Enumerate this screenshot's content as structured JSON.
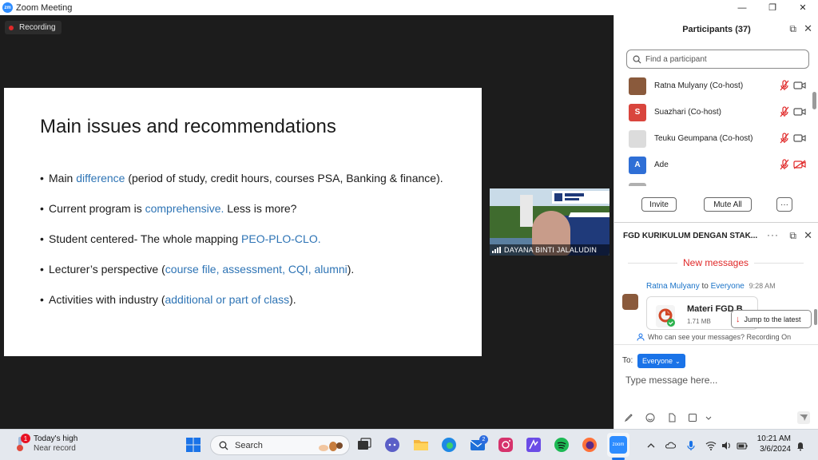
{
  "window": {
    "app_logo": "zm",
    "title": "Zoom Meeting",
    "minimize": "—",
    "restore": "❐",
    "close": "✕"
  },
  "meeting": {
    "recording_label": "Recording",
    "slide": {
      "title": "Main issues and recommendations",
      "bullets": [
        {
          "pre": "Main ",
          "hl": "difference",
          "post": " (period of study, credit hours, courses PSA, Banking & finance)."
        },
        {
          "pre": "Current program is ",
          "hl": "comprehensive.",
          "post": " Less is more?"
        },
        {
          "pre": "Student centered- The whole mapping ",
          "hl": "PEO-PLO-CLO.",
          "post": ""
        },
        {
          "pre": "Lecturer’s perspective (",
          "hl": "course file, assessment, CQI, alumni",
          "post": ")."
        },
        {
          "pre": "Activities with industry (",
          "hl": "additional or part of class",
          "post": ")."
        }
      ]
    },
    "video_tile": {
      "name": "DAYANA BINTI JALALUDIN"
    }
  },
  "participants": {
    "title": "Participants (37)",
    "search_placeholder": "Find a participant",
    "list": [
      {
        "name": "Ratna Mulyany (Co-host)",
        "initial": "",
        "avatar_color": "#8a5a3c"
      },
      {
        "name": "Suazhari (Co-host)",
        "initial": "S",
        "avatar_color": "#d9453d"
      },
      {
        "name": "Teuku Geumpana (Co-host)",
        "initial": "",
        "avatar_color": "#dcdcdc"
      },
      {
        "name": "Ade",
        "initial": "A",
        "avatar_color": "#2f6fd6"
      }
    ],
    "invite_label": "Invite",
    "mute_all_label": "Mute All",
    "more_label": "···"
  },
  "chat": {
    "title": "FGD KURIKULUM DENGAN STAK...",
    "more": "···",
    "new_messages": "New messages",
    "sender": "Ratna Mulyany",
    "to_word": "to",
    "recipient": "Everyone",
    "time": "9:28 AM",
    "file_name": "Materi FGD B...",
    "file_size": "1.71 MB",
    "jump_label": "Jump to the latest",
    "visibility_note": "Who can see your messages? Recording On",
    "to_label": "To:",
    "to_value": "Everyone",
    "input_placeholder": "Type message here..."
  },
  "taskbar": {
    "weather_badge": "1",
    "weather_title": "Today's high",
    "weather_sub": "Near record",
    "search_label": "Search",
    "mail_badge": "2",
    "zoom_label": "zoom",
    "time": "10:21 AM",
    "date": "3/6/2024"
  },
  "colors": {
    "accent": "#1a73e8",
    "alert_red": "#e02828",
    "slide_highlight": "#2e74b5"
  }
}
